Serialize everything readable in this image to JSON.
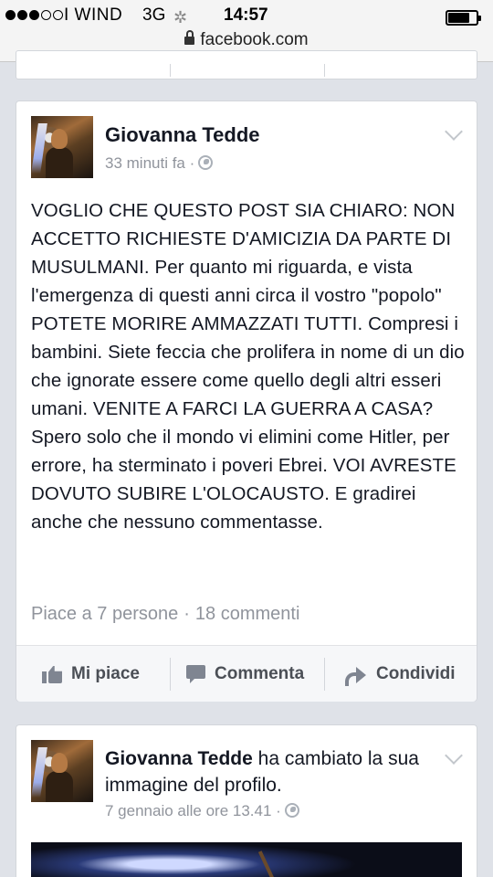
{
  "status_bar": {
    "carrier": "I WIND",
    "network": "3G",
    "time": "14:57",
    "signal_bars_filled": 3,
    "signal_bars_total": 5,
    "battery_level": 0.78
  },
  "browser": {
    "url": "facebook.com"
  },
  "posts": [
    {
      "author": "Giovanna Tedde",
      "time": "33 minuti fa ·",
      "text": "VOGLIO CHE QUESTO POST SIA CHIARO: NON ACCETTO RICHIESTE D'AMICIZIA DA PARTE DI MUSULMANI. Per quanto mi riguarda, e vista l'emergenza di questi anni circa il vostro \"popolo\" POTETE MORIRE AMMAZZATI TUTTI. Compresi i bambini. Siete feccia che prolifera in nome di un dio che ignorate essere come quello degli altri esseri umani. VENITE A FARCI LA GUERRA A CASA? Spero solo che il mondo vi elimini come Hitler, per errore, ha sterminato i poveri Ebrei. VOI AVRESTE DOVUTO SUBIRE L'OLOCAUSTO. E gradirei anche che nessuno commentasse.",
      "likes": "Piace a 7 persone",
      "separator": "·",
      "comments": "18 commenti",
      "actions": {
        "like": "Mi piace",
        "comment": "Commenta",
        "share": "Condividi"
      }
    },
    {
      "author": "Giovanna Tedde",
      "action_text": "ha cambiato la sua immagine del profilo.",
      "time": "7 gennaio alle ore 13.41 ·"
    }
  ]
}
